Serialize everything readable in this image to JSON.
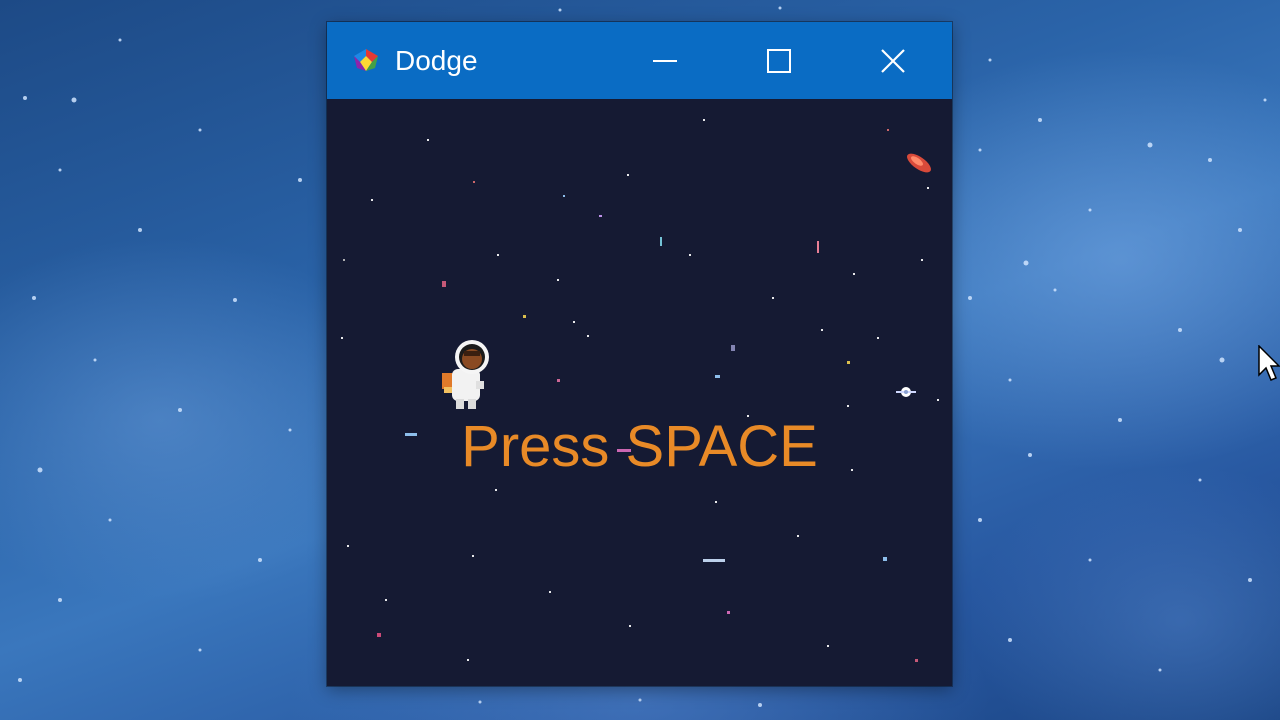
{
  "window": {
    "title": "Dodge",
    "app_icon": "pygame-logo-icon",
    "controls": [
      "minimize-icon",
      "maximize-icon",
      "close-icon"
    ],
    "titlebar_color": "#0a6cc4"
  },
  "game": {
    "message": "Press SPACE",
    "message_color": "#e88a27",
    "background_color": "#151a33",
    "player_sprite": "astronaut-icon",
    "enemy_sprites": [
      "red-asteroid-icon",
      "white-satellite-icon"
    ]
  },
  "desktop": {
    "wallpaper": "blue-starry-sky",
    "cursor": "mouse-pointer-icon"
  }
}
